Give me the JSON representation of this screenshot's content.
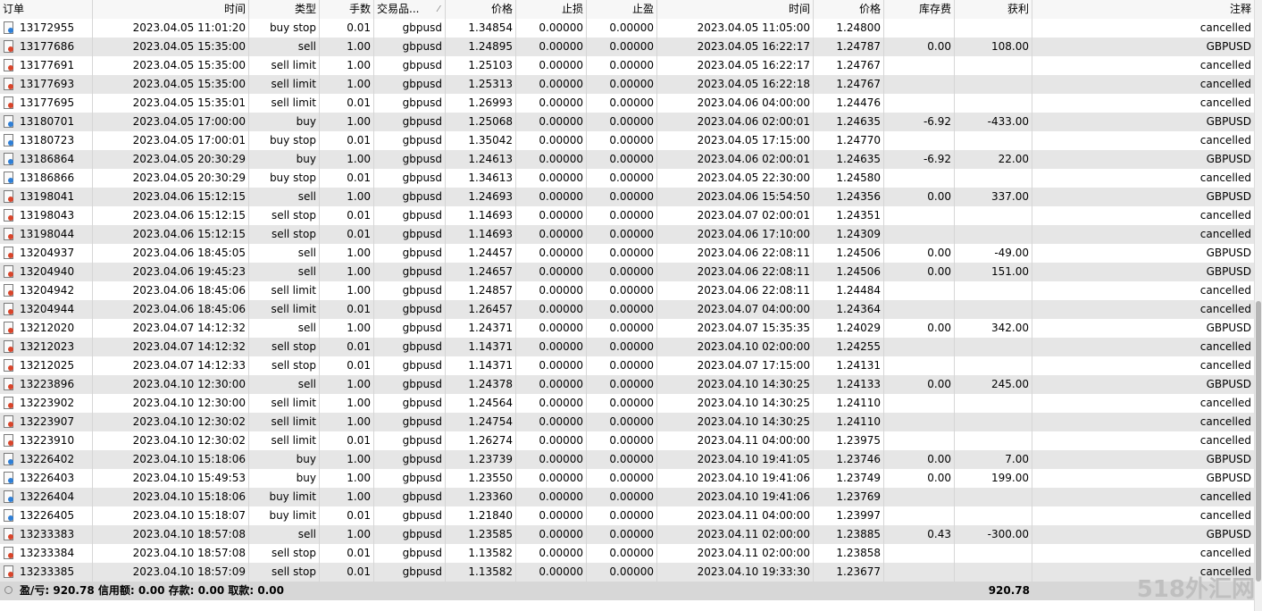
{
  "columns": [
    "订单",
    "时间",
    "类型",
    "手数",
    "交易品...",
    "价格",
    "止损",
    "止盈",
    "时间",
    "价格",
    "库存费",
    "获利",
    "注释"
  ],
  "rows": [
    [
      "13172955",
      "2023.04.05 11:01:20",
      "buy stop",
      "0.01",
      "gbpusd",
      "1.34854",
      "0.00000",
      "0.00000",
      "2023.04.05 11:05:00",
      "1.24800",
      "",
      "",
      "cancelled"
    ],
    [
      "13177686",
      "2023.04.05 15:35:00",
      "sell",
      "1.00",
      "gbpusd",
      "1.24895",
      "0.00000",
      "0.00000",
      "2023.04.05 16:22:17",
      "1.24787",
      "0.00",
      "108.00",
      "GBPUSD"
    ],
    [
      "13177691",
      "2023.04.05 15:35:00",
      "sell limit",
      "1.00",
      "gbpusd",
      "1.25103",
      "0.00000",
      "0.00000",
      "2023.04.05 16:22:17",
      "1.24767",
      "",
      "",
      "cancelled"
    ],
    [
      "13177693",
      "2023.04.05 15:35:00",
      "sell limit",
      "1.00",
      "gbpusd",
      "1.25313",
      "0.00000",
      "0.00000",
      "2023.04.05 16:22:18",
      "1.24767",
      "",
      "",
      "cancelled"
    ],
    [
      "13177695",
      "2023.04.05 15:35:01",
      "sell limit",
      "0.01",
      "gbpusd",
      "1.26993",
      "0.00000",
      "0.00000",
      "2023.04.06 04:00:00",
      "1.24476",
      "",
      "",
      "cancelled"
    ],
    [
      "13180701",
      "2023.04.05 17:00:00",
      "buy",
      "1.00",
      "gbpusd",
      "1.25068",
      "0.00000",
      "0.00000",
      "2023.04.06 02:00:01",
      "1.24635",
      "-6.92",
      "-433.00",
      "GBPUSD"
    ],
    [
      "13180723",
      "2023.04.05 17:00:01",
      "buy stop",
      "0.01",
      "gbpusd",
      "1.35042",
      "0.00000",
      "0.00000",
      "2023.04.05 17:15:00",
      "1.24770",
      "",
      "",
      "cancelled"
    ],
    [
      "13186864",
      "2023.04.05 20:30:29",
      "buy",
      "1.00",
      "gbpusd",
      "1.24613",
      "0.00000",
      "0.00000",
      "2023.04.06 02:00:01",
      "1.24635",
      "-6.92",
      "22.00",
      "GBPUSD"
    ],
    [
      "13186866",
      "2023.04.05 20:30:29",
      "buy stop",
      "0.01",
      "gbpusd",
      "1.34613",
      "0.00000",
      "0.00000",
      "2023.04.05 22:30:00",
      "1.24580",
      "",
      "",
      "cancelled"
    ],
    [
      "13198041",
      "2023.04.06 15:12:15",
      "sell",
      "1.00",
      "gbpusd",
      "1.24693",
      "0.00000",
      "0.00000",
      "2023.04.06 15:54:50",
      "1.24356",
      "0.00",
      "337.00",
      "GBPUSD"
    ],
    [
      "13198043",
      "2023.04.06 15:12:15",
      "sell stop",
      "0.01",
      "gbpusd",
      "1.14693",
      "0.00000",
      "0.00000",
      "2023.04.07 02:00:01",
      "1.24351",
      "",
      "",
      "cancelled"
    ],
    [
      "13198044",
      "2023.04.06 15:12:15",
      "sell stop",
      "0.01",
      "gbpusd",
      "1.14693",
      "0.00000",
      "0.00000",
      "2023.04.06 17:10:00",
      "1.24309",
      "",
      "",
      "cancelled"
    ],
    [
      "13204937",
      "2023.04.06 18:45:05",
      "sell",
      "1.00",
      "gbpusd",
      "1.24457",
      "0.00000",
      "0.00000",
      "2023.04.06 22:08:11",
      "1.24506",
      "0.00",
      "-49.00",
      "GBPUSD"
    ],
    [
      "13204940",
      "2023.04.06 19:45:23",
      "sell",
      "1.00",
      "gbpusd",
      "1.24657",
      "0.00000",
      "0.00000",
      "2023.04.06 22:08:11",
      "1.24506",
      "0.00",
      "151.00",
      "GBPUSD"
    ],
    [
      "13204942",
      "2023.04.06 18:45:06",
      "sell limit",
      "1.00",
      "gbpusd",
      "1.24857",
      "0.00000",
      "0.00000",
      "2023.04.06 22:08:11",
      "1.24484",
      "",
      "",
      "cancelled"
    ],
    [
      "13204944",
      "2023.04.06 18:45:06",
      "sell limit",
      "0.01",
      "gbpusd",
      "1.26457",
      "0.00000",
      "0.00000",
      "2023.04.07 04:00:00",
      "1.24364",
      "",
      "",
      "cancelled"
    ],
    [
      "13212020",
      "2023.04.07 14:12:32",
      "sell",
      "1.00",
      "gbpusd",
      "1.24371",
      "0.00000",
      "0.00000",
      "2023.04.07 15:35:35",
      "1.24029",
      "0.00",
      "342.00",
      "GBPUSD"
    ],
    [
      "13212023",
      "2023.04.07 14:12:32",
      "sell stop",
      "0.01",
      "gbpusd",
      "1.14371",
      "0.00000",
      "0.00000",
      "2023.04.10 02:00:00",
      "1.24255",
      "",
      "",
      "cancelled"
    ],
    [
      "13212025",
      "2023.04.07 14:12:33",
      "sell stop",
      "0.01",
      "gbpusd",
      "1.14371",
      "0.00000",
      "0.00000",
      "2023.04.07 17:15:00",
      "1.24131",
      "",
      "",
      "cancelled"
    ],
    [
      "13223896",
      "2023.04.10 12:30:00",
      "sell",
      "1.00",
      "gbpusd",
      "1.24378",
      "0.00000",
      "0.00000",
      "2023.04.10 14:30:25",
      "1.24133",
      "0.00",
      "245.00",
      "GBPUSD"
    ],
    [
      "13223902",
      "2023.04.10 12:30:00",
      "sell limit",
      "1.00",
      "gbpusd",
      "1.24564",
      "0.00000",
      "0.00000",
      "2023.04.10 14:30:25",
      "1.24110",
      "",
      "",
      "cancelled"
    ],
    [
      "13223907",
      "2023.04.10 12:30:02",
      "sell limit",
      "1.00",
      "gbpusd",
      "1.24754",
      "0.00000",
      "0.00000",
      "2023.04.10 14:30:25",
      "1.24110",
      "",
      "",
      "cancelled"
    ],
    [
      "13223910",
      "2023.04.10 12:30:02",
      "sell limit",
      "0.01",
      "gbpusd",
      "1.26274",
      "0.00000",
      "0.00000",
      "2023.04.11 04:00:00",
      "1.23975",
      "",
      "",
      "cancelled"
    ],
    [
      "13226402",
      "2023.04.10 15:18:06",
      "buy",
      "1.00",
      "gbpusd",
      "1.23739",
      "0.00000",
      "0.00000",
      "2023.04.10 19:41:05",
      "1.23746",
      "0.00",
      "7.00",
      "GBPUSD"
    ],
    [
      "13226403",
      "2023.04.10 15:49:53",
      "buy",
      "1.00",
      "gbpusd",
      "1.23550",
      "0.00000",
      "0.00000",
      "2023.04.10 19:41:06",
      "1.23749",
      "0.00",
      "199.00",
      "GBPUSD"
    ],
    [
      "13226404",
      "2023.04.10 15:18:06",
      "buy limit",
      "1.00",
      "gbpusd",
      "1.23360",
      "0.00000",
      "0.00000",
      "2023.04.10 19:41:06",
      "1.23769",
      "",
      "",
      "cancelled"
    ],
    [
      "13226405",
      "2023.04.10 15:18:07",
      "buy limit",
      "0.01",
      "gbpusd",
      "1.21840",
      "0.00000",
      "0.00000",
      "2023.04.11 04:00:00",
      "1.23997",
      "",
      "",
      "cancelled"
    ],
    [
      "13233383",
      "2023.04.10 18:57:08",
      "sell",
      "1.00",
      "gbpusd",
      "1.23585",
      "0.00000",
      "0.00000",
      "2023.04.11 02:00:00",
      "1.23885",
      "0.43",
      "-300.00",
      "GBPUSD"
    ],
    [
      "13233384",
      "2023.04.10 18:57:08",
      "sell stop",
      "0.01",
      "gbpusd",
      "1.13582",
      "0.00000",
      "0.00000",
      "2023.04.11 02:00:00",
      "1.23858",
      "",
      "",
      "cancelled"
    ],
    [
      "13233385",
      "2023.04.10 18:57:09",
      "sell stop",
      "0.01",
      "gbpusd",
      "1.13582",
      "0.00000",
      "0.00000",
      "2023.04.10 19:33:30",
      "1.23677",
      "",
      "",
      "cancelled"
    ]
  ],
  "footer": {
    "summary": "盈/亏: 920.78  信用额: 0.00  存款: 0.00  取款: 0.00",
    "total": "920.78"
  },
  "watermark": "518外汇网",
  "colors": {
    "buy_icon": "#2f7fd6",
    "sell_icon": "#d9452b",
    "alt_row": "#e6e6e6"
  }
}
